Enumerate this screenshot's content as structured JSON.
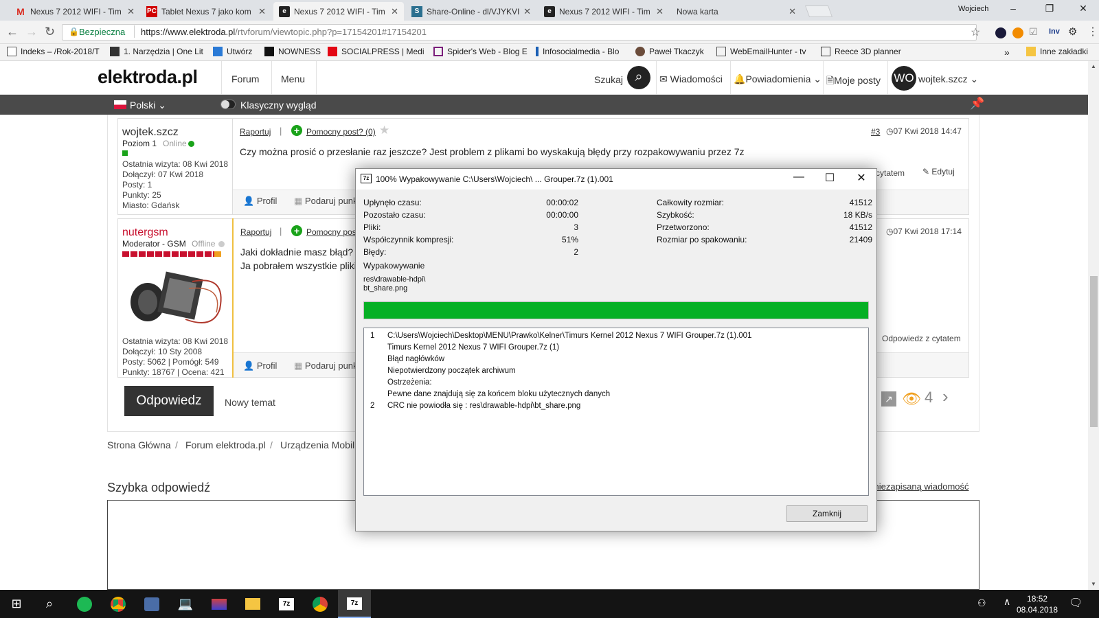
{
  "browser": {
    "tabs": [
      {
        "title": "Nexus 7 2012 WIFI - Tim",
        "icon": "gmail-icon",
        "color": "#d93025"
      },
      {
        "title": "Tablet Nexus 7 jako kom",
        "icon": "pc-icon",
        "color": "#d00000"
      },
      {
        "title": "Nexus 7 2012 WIFI - Tim",
        "icon": "elektroda-icon",
        "color": "#222222"
      },
      {
        "title": "Share-Online - dl/VJYKVI",
        "icon": "share-online-icon",
        "color": "#2a6f8f"
      },
      {
        "title": "Nexus 7 2012 WIFI - Tim",
        "icon": "elektroda-icon",
        "color": "#222222"
      },
      {
        "title": "Nowa karta",
        "icon": "",
        "color": ""
      }
    ],
    "user_label": "Wojciech",
    "secure_label": "Bezpieczna",
    "url_main": "https://www.elektroda.pl",
    "url_rest": "/rtvforum/viewtopic.php?p=17154201#17154201",
    "extension_label": "Inv",
    "bookmarks": [
      "Indeks – /Rok-2018/T",
      "1. Narzędzia | One Lit",
      "Utwórz",
      "NOWNESS",
      "SOCIALPRESS | Medi",
      "Spider's Web - Blog E",
      "Infosocialmedia - Blo",
      "Paweł Tkaczyk",
      "WebEmailHunter - tv",
      "Reece 3D planner"
    ],
    "bookmarks_more": "»",
    "other_bookmarks": "Inne zakładki"
  },
  "site": {
    "logo": "elektroda.pl",
    "nav_forum": "Forum",
    "nav_menu": "Menu",
    "search_label": "Szukaj",
    "messages": "Wiadomości",
    "notifications": "Powiadomienia",
    "my_posts": "Moje posty",
    "avatar_initials": "WO",
    "username": "wojtek.szcz",
    "language": "Polski",
    "classic_view": "Klasyczny wygląd"
  },
  "posts": [
    {
      "user": "wojtek.szcz",
      "level": "Poziom 1",
      "status": "Online",
      "last_visit": "Ostatnia wizyta: 08 Kwi 2018",
      "joined": "Dołączył: 07 Kwi 2018",
      "posts": "Posty: 1",
      "points": "Punkty: 25",
      "city": "Miasto: Gdańsk",
      "report": "Raportuj",
      "helpful": "Pomocny post? (0)",
      "number": "#3",
      "date": "07 Kwi 2018 14:47",
      "text": "Czy można prosić o przesłanie raz jeszcze? Jest problem z plikami bo wyskakują błędy przy rozpakowywaniu przez 7z",
      "quote": "cytatem",
      "edit": "Edytuj",
      "profile": "Profil",
      "give_points": "Podaruj punk"
    },
    {
      "user": "nutergsm",
      "level": "Moderator - GSM",
      "status": "Offline",
      "last_visit": "Ostatnia wizyta: 08 Kwi 2018",
      "joined": "Dołączył: 10 Sty 2008",
      "posts": "Posty: 5062 | Pomógł: 549",
      "points": "Punkty: 18767 | Ocena: 421",
      "report": "Raportuj",
      "helpful": "Pomocny post",
      "date": "07 Kwi 2018 17:14",
      "text1": "Jaki dokładnie masz błąd? V",
      "text2": "Ja pobrałem wszystkie pliki",
      "quote": "Odpowiedz z cytatem",
      "profile": "Profil",
      "give_points": "Podaruj punk"
    }
  ],
  "reply_button": "Odpowiedz",
  "new_topic": "Nowy temat",
  "views_count": "4",
  "breadcrumb": [
    "Strona Główna",
    "Forum elektroda.pl",
    "Urządzenia Mobil"
  ],
  "quick_reply": "Szybka odpowiedź",
  "unsaved_link": "j niezapisaną wiadomość",
  "dialog": {
    "title": "100% Wypakowywanie C:\\Users\\Wojciech\\ ... Grouper.7z (1).001",
    "icon_label": "7z",
    "left": [
      {
        "label": "Upłynęło czasu:",
        "value": "00:00:02"
      },
      {
        "label": "Pozostało czasu:",
        "value": "00:00:00"
      },
      {
        "label": "Pliki:",
        "value": "3"
      },
      {
        "label": "Współczynnik kompresji:",
        "value": "51%"
      },
      {
        "label": "Błędy:",
        "value": "2"
      }
    ],
    "right": [
      {
        "label": "Całkowity rozmiar:",
        "value": "41512"
      },
      {
        "label": "Szybkość:",
        "value": "18 KB/s"
      },
      {
        "label": "Przetworzono:",
        "value": "41512"
      },
      {
        "label": "Rozmiar po spakowaniu:",
        "value": "21409"
      }
    ],
    "operation": "Wypakowywanie",
    "current_path": "res\\drawable-hdpi\\",
    "current_file": "bt_share.png",
    "progress": 100,
    "messages": [
      {
        "n": "1",
        "text": "C:\\Users\\Wojciech\\Desktop\\MENU\\Prawko\\Kelner\\Timurs Kernel 2012 Nexus 7 WIFI Grouper.7z (1).001"
      },
      {
        "n": "",
        "text": "Timurs Kernel 2012 Nexus 7 WIFI Grouper.7z (1)"
      },
      {
        "n": "",
        "text": "Błąd nagłówków"
      },
      {
        "n": "",
        "text": "Niepotwierdzony początek archiwum"
      },
      {
        "n": "",
        "text": "Ostrzeżenia:"
      },
      {
        "n": "",
        "text": "Pewne dane znajdują się za końcem bloku użytecznych danych"
      },
      {
        "n": "2",
        "text": "CRC nie powiodła się : res\\drawable-hdpi\\bt_share.png"
      }
    ],
    "close_button": "Zamknij"
  },
  "taskbar": {
    "time": "18:52",
    "date": "08.04.2018",
    "apps": [
      "start-icon",
      "search-icon",
      "spotify-icon",
      "chrome-icon",
      "app-icon",
      "laptop-icon",
      "media-icon",
      "folder-icon",
      "7zip-icon",
      "chrome-user-icon",
      "7zip-active-icon"
    ]
  }
}
